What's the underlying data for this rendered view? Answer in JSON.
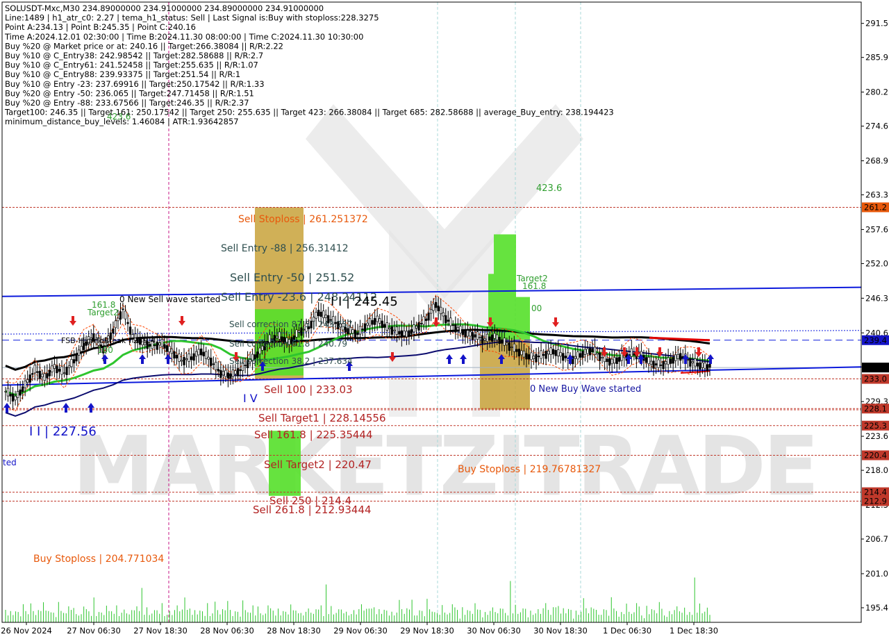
{
  "colors": {
    "background": "#ffffff",
    "grid": "#c8c8c8",
    "axis": "#000000",
    "blue_line": "#0c1adc",
    "black_line": "#000000",
    "green_line": "#2ec52e",
    "navy_line": "#0b0b6e",
    "red_dash": "#c0392b",
    "zone_orange": "#c8a23a",
    "zone_green": "#55e02a",
    "dark_red_label": "#b22222",
    "orange_text": "#e8590c",
    "green_text": "#2e9e2e",
    "label_brown": "#a04020",
    "current_price_bg": "#000000",
    "blue_label_bg": "#1414c8"
  },
  "info_lines": [
    "SOLUSDT-Mxc,M30  234.89000000 234.91000000 234.89000000 234.91000000",
    "Line:1489 | h1_atr_c0: 2.27 | tema_h1_status: Sell | Last Signal is:Buy with stoploss:228.3275",
    "Point A:234.13 | Point B:245.35 | Point C:240.16",
    "Time A:2024.12.01 02:30:00 | Time B:2024.11.30 08:00:00 | Time C:2024.11.30 10:30:00",
    "Buy %20 @ Market price or at: 240.16 || Target:266.38084 || R/R:2.22",
    "Buy %10 @ C_Entry38: 242.98542 || Target:282.58688 || R/R:2.7",
    "Buy %10 @ C_Entry61: 241.52458 || Target:255.635 || R/R:1.07",
    "Buy %10 @ C_Entry88: 239.93375 || Target:251.54 || R/R:1",
    "Buy %10 @ Entry -23: 237.69916 || Target:250.17542 || R/R:1.33",
    "Buy %20 @ Entry -50: 236.065 || Target:247.71458 || R/R:1.51",
    "Buy %20 @ Entry -88: 233.67566 || Target:246.35 || R/R:2.37",
    "Target100: 246.35 || Target 161: 250.17542 || Target 250: 255.635 || Target 423: 266.38084 || Target 685: 282.58688 || average_Buy_entry: 238.194423",
    "minimum_distance_buy_levels: 1.46084 | ATR:1.93642857"
  ],
  "watermark": "MARKETZITRADE",
  "chart_data": {
    "type": "candlestick",
    "symbol": "SOLUSDT-Mxc",
    "timeframe": "M30",
    "ylim": [
      193.0,
      295.0
    ],
    "y_ticks": [
      "291.5",
      "285.9",
      "280.2",
      "274.6",
      "268.9",
      "263.3",
      "257.6",
      "252.0",
      "246.3",
      "240.6",
      "235.0",
      "229.3",
      "223.6",
      "218.0",
      "212.3",
      "206.7",
      "201.0",
      "195.4"
    ],
    "x_labels": [
      "26 Nov 2024",
      "27 Nov 06:30",
      "27 Nov 18:30",
      "28 Nov 06:30",
      "28 Nov 18:30",
      "29 Nov 06:30",
      "29 Nov 18:30",
      "30 Nov 06:30",
      "30 Nov 18:30",
      "1 Dec 06:30",
      "1 Dec 18:30"
    ],
    "price_tags": [
      {
        "text": "261.2",
        "value": 261.25,
        "color": "#e8590c"
      },
      {
        "text": "239.4",
        "value": 239.4,
        "color": "#1414c8"
      },
      {
        "text": "234.9",
        "value": 234.9,
        "color": "#000000"
      },
      {
        "text": "233.0",
        "value": 233.03,
        "color": "#c0392b"
      },
      {
        "text": "228.1",
        "value": 228.15,
        "color": "#c0392b"
      },
      {
        "text": "225.3",
        "value": 225.35,
        "color": "#c0392b"
      },
      {
        "text": "220.4",
        "value": 220.47,
        "color": "#c0392b"
      },
      {
        "text": "214.4",
        "value": 214.4,
        "color": "#c0392b"
      },
      {
        "text": "212.9",
        "value": 212.93,
        "color": "#c0392b"
      }
    ],
    "horizontal_levels": [
      261.25,
      233.03,
      228.15,
      227.95,
      225.35,
      220.47,
      214.4,
      212.93
    ],
    "dashed_blue_level": 239.4,
    "close_series": [
      231.0,
      229.8,
      232.0,
      234.5,
      233.2,
      235.0,
      234.0,
      236.0,
      238.5,
      240.0,
      238.0,
      241.0,
      244.5,
      240.0,
      239.0,
      238.5,
      238.8,
      237.5,
      236.0,
      236.5,
      237.6,
      236.0,
      234.0,
      233.6,
      234.5,
      236.0,
      237.5,
      239.5,
      240.0,
      239.0,
      240.8,
      241.5,
      244.0,
      243.0,
      242.0,
      241.0,
      240.5,
      242.0,
      242.8,
      241.5,
      240.8,
      240.3,
      241.5,
      242.8,
      245.3,
      243.0,
      241.5,
      240.5,
      240.16,
      239.5,
      240.0,
      239.0,
      238.0,
      237.0,
      236.5,
      237.0,
      237.6,
      236.8,
      236.3,
      237.2,
      237.8,
      236.5,
      235.8,
      236.5,
      237.2,
      236.9,
      235.6,
      235.3,
      236.0,
      236.8,
      235.9,
      235.3,
      234.91
    ],
    "volumes": [
      40,
      20,
      30,
      18,
      25,
      22,
      12,
      34,
      20,
      26,
      55,
      30,
      18,
      28,
      24,
      40,
      22,
      20,
      32,
      28,
      14,
      50,
      26,
      20,
      18,
      30,
      22,
      46,
      24,
      18,
      20,
      36,
      28,
      22,
      12,
      44,
      20,
      30,
      26,
      18,
      38,
      24,
      22,
      16,
      30,
      20,
      28,
      34,
      22,
      18,
      26,
      24,
      30,
      20,
      110,
      22,
      40,
      18,
      20,
      26,
      24,
      16,
      34,
      20,
      22,
      30,
      18,
      28,
      36,
      22,
      24,
      44,
      40
    ],
    "annotations": [
      {
        "text": "423.6",
        "color": "#2e9e2e",
        "size": 12
      },
      {
        "text": "423.6",
        "color": "#2e9e2e",
        "size": 13
      },
      {
        "text": "161.8",
        "color": "#2e9e2e",
        "size": 12
      },
      {
        "text": "Target2",
        "color": "#2e9e2e",
        "size": 12
      },
      {
        "text": "Target2",
        "color": "#2e9e2e",
        "size": 12
      },
      {
        "text": "161.8",
        "color": "#2e9e2e",
        "size": 12
      },
      {
        "text": "00",
        "color": "#2e9e2e",
        "size": 12
      },
      {
        "text": "0 New Sell wave started",
        "color": "#000000",
        "size": 12
      },
      {
        "text": "0 New Buy Wave started",
        "color": "#1414a0",
        "size": 13
      },
      {
        "text": "Sell Stoploss | 261.251372",
        "color": "#e8590c",
        "size": 14
      },
      {
        "text": "Sell Entry -88 | 256.31412",
        "color": "#2f4f4f",
        "size": 14
      },
      {
        "text": "Sell Entry -50 | 251.52",
        "color": "#2f4f4f",
        "size": 16
      },
      {
        "text": "Sell Entry -23.6 | 248.24112",
        "color": "#2f4f4f",
        "size": 16
      },
      {
        "text": "Sell correction 87.5 | 243.757",
        "color": "#2f4f4f",
        "size": 12
      },
      {
        "text": "Sell correction 61.8 | 240.79",
        "color": "#2f4f4f",
        "size": 12
      },
      {
        "text": "Sell correction 38.2 | 237.634",
        "color": "#2f4f4f",
        "size": 12
      },
      {
        "text": "FSB-HighToBreak | 239.4",
        "color": "#000000",
        "size": 11
      },
      {
        "text": "100",
        "color": "#2e9e2e",
        "size": 12
      },
      {
        "text": "Sell 100 | 233.03",
        "color": "#b22222",
        "size": 15
      },
      {
        "text": "Sell Target1 | 228.14556",
        "color": "#b22222",
        "size": 15
      },
      {
        "text": "Sell 161.8 | 225.35444",
        "color": "#b22222",
        "size": 15
      },
      {
        "text": "Sell Target2 | 220.47",
        "color": "#b22222",
        "size": 15
      },
      {
        "text": "Sell  250 | 214.4",
        "color": "#b22222",
        "size": 15
      },
      {
        "text": "Sell  261.8 | 212.93444",
        "color": "#b22222",
        "size": 15
      },
      {
        "text": "Buy Stoploss | 219.76781327",
        "color": "#e8590c",
        "size": 14
      },
      {
        "text": "Buy Stoploss | 204.771034",
        "color": "#e8590c",
        "size": 14
      },
      {
        "text": "I I | 245.45",
        "color": "#000000",
        "size": 18
      },
      {
        "text": "I I | 227.56",
        "color": "#1414c8",
        "size": 18
      },
      {
        "text": "I V",
        "color": "#1414c8",
        "size": 16
      },
      {
        "text": "ted",
        "color": "#1414c8",
        "size": 12
      }
    ]
  }
}
